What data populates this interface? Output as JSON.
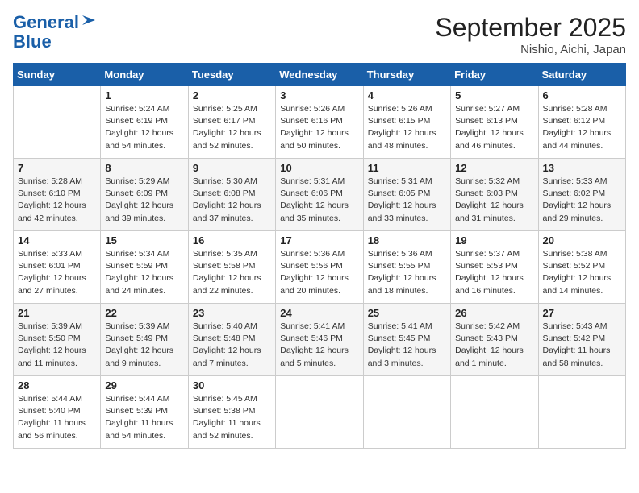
{
  "logo": {
    "line1": "General",
    "line2": "Blue"
  },
  "title": "September 2025",
  "location": "Nishio, Aichi, Japan",
  "weekdays": [
    "Sunday",
    "Monday",
    "Tuesday",
    "Wednesday",
    "Thursday",
    "Friday",
    "Saturday"
  ],
  "weeks": [
    [
      {
        "day": "",
        "info": ""
      },
      {
        "day": "1",
        "info": "Sunrise: 5:24 AM\nSunset: 6:19 PM\nDaylight: 12 hours\nand 54 minutes."
      },
      {
        "day": "2",
        "info": "Sunrise: 5:25 AM\nSunset: 6:17 PM\nDaylight: 12 hours\nand 52 minutes."
      },
      {
        "day": "3",
        "info": "Sunrise: 5:26 AM\nSunset: 6:16 PM\nDaylight: 12 hours\nand 50 minutes."
      },
      {
        "day": "4",
        "info": "Sunrise: 5:26 AM\nSunset: 6:15 PM\nDaylight: 12 hours\nand 48 minutes."
      },
      {
        "day": "5",
        "info": "Sunrise: 5:27 AM\nSunset: 6:13 PM\nDaylight: 12 hours\nand 46 minutes."
      },
      {
        "day": "6",
        "info": "Sunrise: 5:28 AM\nSunset: 6:12 PM\nDaylight: 12 hours\nand 44 minutes."
      }
    ],
    [
      {
        "day": "7",
        "info": "Sunrise: 5:28 AM\nSunset: 6:10 PM\nDaylight: 12 hours\nand 42 minutes."
      },
      {
        "day": "8",
        "info": "Sunrise: 5:29 AM\nSunset: 6:09 PM\nDaylight: 12 hours\nand 39 minutes."
      },
      {
        "day": "9",
        "info": "Sunrise: 5:30 AM\nSunset: 6:08 PM\nDaylight: 12 hours\nand 37 minutes."
      },
      {
        "day": "10",
        "info": "Sunrise: 5:31 AM\nSunset: 6:06 PM\nDaylight: 12 hours\nand 35 minutes."
      },
      {
        "day": "11",
        "info": "Sunrise: 5:31 AM\nSunset: 6:05 PM\nDaylight: 12 hours\nand 33 minutes."
      },
      {
        "day": "12",
        "info": "Sunrise: 5:32 AM\nSunset: 6:03 PM\nDaylight: 12 hours\nand 31 minutes."
      },
      {
        "day": "13",
        "info": "Sunrise: 5:33 AM\nSunset: 6:02 PM\nDaylight: 12 hours\nand 29 minutes."
      }
    ],
    [
      {
        "day": "14",
        "info": "Sunrise: 5:33 AM\nSunset: 6:01 PM\nDaylight: 12 hours\nand 27 minutes."
      },
      {
        "day": "15",
        "info": "Sunrise: 5:34 AM\nSunset: 5:59 PM\nDaylight: 12 hours\nand 24 minutes."
      },
      {
        "day": "16",
        "info": "Sunrise: 5:35 AM\nSunset: 5:58 PM\nDaylight: 12 hours\nand 22 minutes."
      },
      {
        "day": "17",
        "info": "Sunrise: 5:36 AM\nSunset: 5:56 PM\nDaylight: 12 hours\nand 20 minutes."
      },
      {
        "day": "18",
        "info": "Sunrise: 5:36 AM\nSunset: 5:55 PM\nDaylight: 12 hours\nand 18 minutes."
      },
      {
        "day": "19",
        "info": "Sunrise: 5:37 AM\nSunset: 5:53 PM\nDaylight: 12 hours\nand 16 minutes."
      },
      {
        "day": "20",
        "info": "Sunrise: 5:38 AM\nSunset: 5:52 PM\nDaylight: 12 hours\nand 14 minutes."
      }
    ],
    [
      {
        "day": "21",
        "info": "Sunrise: 5:39 AM\nSunset: 5:50 PM\nDaylight: 12 hours\nand 11 minutes."
      },
      {
        "day": "22",
        "info": "Sunrise: 5:39 AM\nSunset: 5:49 PM\nDaylight: 12 hours\nand 9 minutes."
      },
      {
        "day": "23",
        "info": "Sunrise: 5:40 AM\nSunset: 5:48 PM\nDaylight: 12 hours\nand 7 minutes."
      },
      {
        "day": "24",
        "info": "Sunrise: 5:41 AM\nSunset: 5:46 PM\nDaylight: 12 hours\nand 5 minutes."
      },
      {
        "day": "25",
        "info": "Sunrise: 5:41 AM\nSunset: 5:45 PM\nDaylight: 12 hours\nand 3 minutes."
      },
      {
        "day": "26",
        "info": "Sunrise: 5:42 AM\nSunset: 5:43 PM\nDaylight: 12 hours\nand 1 minute."
      },
      {
        "day": "27",
        "info": "Sunrise: 5:43 AM\nSunset: 5:42 PM\nDaylight: 11 hours\nand 58 minutes."
      }
    ],
    [
      {
        "day": "28",
        "info": "Sunrise: 5:44 AM\nSunset: 5:40 PM\nDaylight: 11 hours\nand 56 minutes."
      },
      {
        "day": "29",
        "info": "Sunrise: 5:44 AM\nSunset: 5:39 PM\nDaylight: 11 hours\nand 54 minutes."
      },
      {
        "day": "30",
        "info": "Sunrise: 5:45 AM\nSunset: 5:38 PM\nDaylight: 11 hours\nand 52 minutes."
      },
      {
        "day": "",
        "info": ""
      },
      {
        "day": "",
        "info": ""
      },
      {
        "day": "",
        "info": ""
      },
      {
        "day": "",
        "info": ""
      }
    ]
  ]
}
